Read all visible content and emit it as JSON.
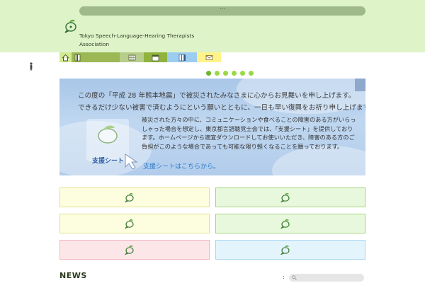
{
  "header": {
    "top_bar_text": "···",
    "org_name": "Tokyo Speech-Language-Hearing Therapists Association",
    "background": "#dff3c8",
    "logo_icon": "leaf-speech-bubble-icon"
  },
  "nav": {
    "items": [
      {
        "icon": "home-icon",
        "color": "#d4ea92"
      },
      {
        "icon": "door-icon",
        "color": "#9bb855"
      },
      {
        "icon": "grid-icon",
        "color": "#b6cd8b"
      },
      {
        "icon": "calendar-icon",
        "color": "#8fb33e"
      },
      {
        "icon": "books-icon",
        "color": "#9ccdf0"
      },
      {
        "icon": "mail-icon",
        "color": "#fff389"
      }
    ]
  },
  "slider": {
    "dot_count": 6,
    "active_index": 0,
    "accent": "#98d944"
  },
  "banner": {
    "line1": "この度の「平成 28 年熊本地震」で被災されたみなさまに心からお見舞いを申し上げます。",
    "line2": "できるだけ少ない被害で済むようにという願いとともに、一日も早い復興をお祈り申し上げます。",
    "body": "被災された方々の中に、コミュニケーションや食べることの障害のある方がいらっしゃった場合を想定し、東京都言語聴覚士会では、「支援シート」を提供しております。ホームページから適宜ダウンロードしてお使いいただき、障害のある方のご負担がこのような場合であっても可能な限り軽くなることを願っております。",
    "support_label": "支援シート",
    "support_link": "支援シートはこちらから。"
  },
  "cards": [
    {
      "bg": "#fdfde0",
      "border": "#e0e38e"
    },
    {
      "bg": "#e8f8dc",
      "border": "#a5d57e"
    },
    {
      "bg": "#fdfde0",
      "border": "#e0e38e"
    },
    {
      "bg": "#e8f8dc",
      "border": "#a5d57e"
    },
    {
      "bg": "#fde6e8",
      "border": "#f0b7bd"
    },
    {
      "bg": "#e3f4fd",
      "border": "#a9d6f1"
    }
  ],
  "news": {
    "title": "NEWS",
    "search_colon": ":"
  }
}
